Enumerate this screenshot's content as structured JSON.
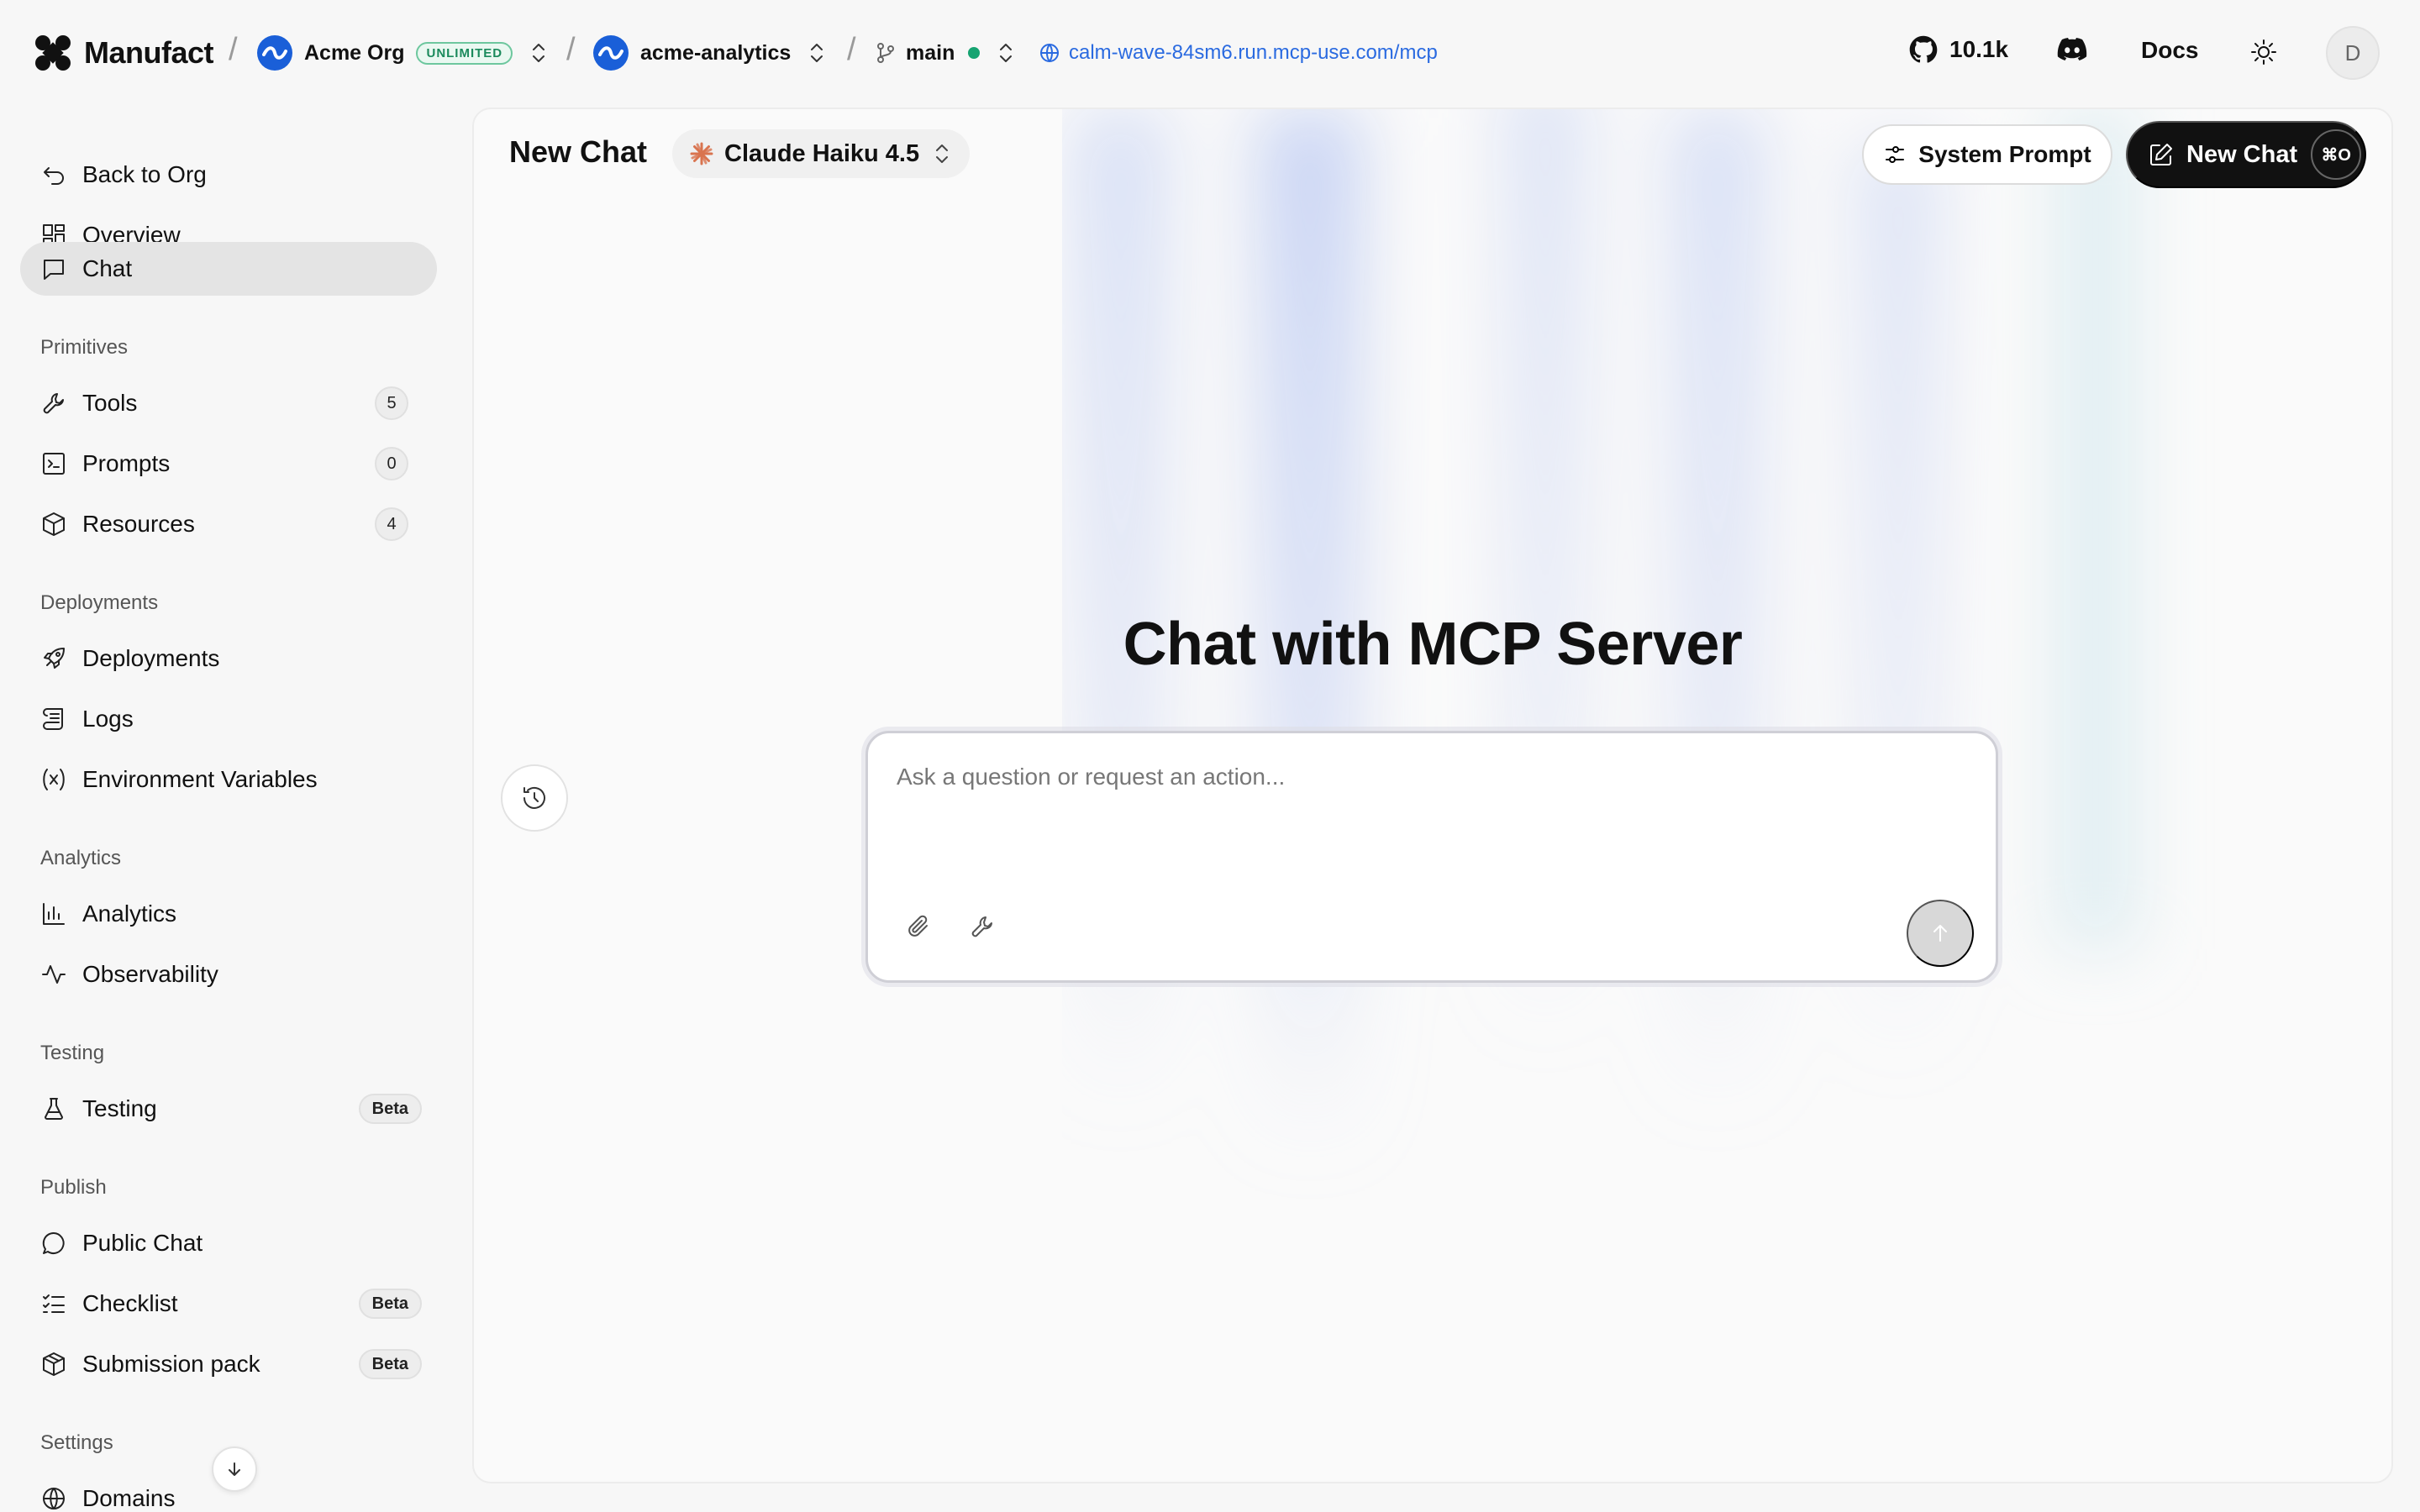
{
  "topbar": {
    "brand": "Manufact",
    "separator": "/",
    "org": {
      "name": "Acme Org",
      "plan_badge": "UNLIMITED"
    },
    "project": {
      "name": "acme-analytics"
    },
    "branch": {
      "name": "main",
      "status_color": "#16a371"
    },
    "url": "calm-wave-84sm6.run.mcp-use.com/mcp",
    "github_stars": "10.1k",
    "docs_label": "Docs",
    "user_initial": "D"
  },
  "sidebar": {
    "top_items": [
      {
        "label": "Back to Org",
        "icon": "back-arrow-icon"
      },
      {
        "label": "Overview",
        "icon": "grid-icon"
      },
      {
        "label": "Chat",
        "icon": "chat-icon",
        "active": true
      }
    ],
    "sections": [
      {
        "title": "Primitives",
        "items": [
          {
            "label": "Tools",
            "icon": "wrench-icon",
            "count": "5"
          },
          {
            "label": "Prompts",
            "icon": "terminal-icon",
            "count": "0"
          },
          {
            "label": "Resources",
            "icon": "box-icon",
            "count": "4"
          }
        ]
      },
      {
        "title": "Deployments",
        "items": [
          {
            "label": "Deployments",
            "icon": "rocket-icon"
          },
          {
            "label": "Logs",
            "icon": "scroll-icon"
          },
          {
            "label": "Environment Variables",
            "icon": "variable-icon"
          }
        ]
      },
      {
        "title": "Analytics",
        "items": [
          {
            "label": "Analytics",
            "icon": "bar-chart-icon"
          },
          {
            "label": "Observability",
            "icon": "activity-icon"
          }
        ]
      },
      {
        "title": "Testing",
        "items": [
          {
            "label": "Testing",
            "icon": "flask-icon",
            "badge": "Beta"
          }
        ]
      },
      {
        "title": "Publish",
        "items": [
          {
            "label": "Public Chat",
            "icon": "message-circle-icon"
          },
          {
            "label": "Checklist",
            "icon": "list-checks-icon",
            "badge": "Beta"
          },
          {
            "label": "Submission pack",
            "icon": "package-icon",
            "badge": "Beta"
          }
        ]
      },
      {
        "title": "Settings",
        "items": [
          {
            "label": "Domains",
            "icon": "globe-icon"
          }
        ]
      }
    ]
  },
  "main": {
    "title": "New Chat",
    "model": "Claude Haiku 4.5",
    "system_prompt_label": "System Prompt",
    "new_chat_label": "New Chat",
    "new_chat_shortcut": "⌘O",
    "hero": "Chat with MCP Server",
    "composer": {
      "placeholder": "Ask a question or request an action...",
      "value": ""
    }
  },
  "colors": {
    "accent": "#1a5fd8",
    "link": "#2a6ae0",
    "status_green": "#16a371",
    "primary_button": "#111111"
  }
}
